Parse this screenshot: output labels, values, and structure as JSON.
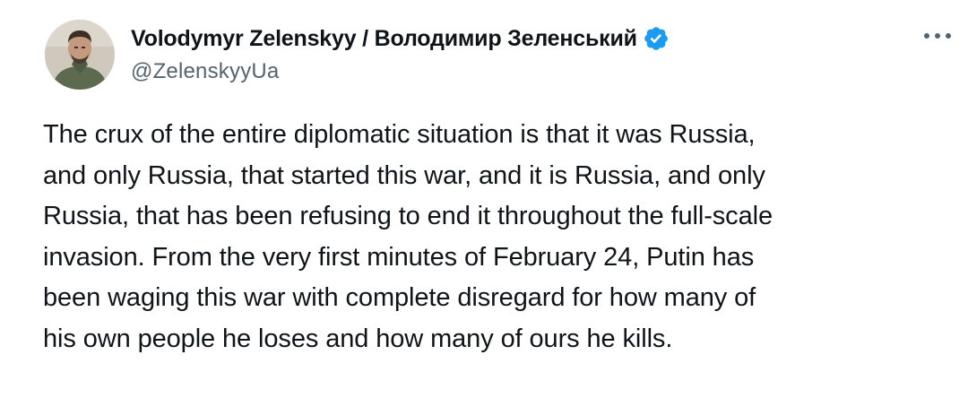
{
  "author": {
    "display_name": "Volodymyr Zelenskyy / Володимир Зеленський",
    "handle": "@ZelenskyyUa",
    "verified_icon": "verified-badge-icon",
    "verified_color": "#1d9bf0"
  },
  "menu": {
    "icon": "more-options-icon"
  },
  "tweet": {
    "lines": [
      "The crux of the entire diplomatic situation is that it was Russia,",
      "and only Russia, that started this war, and it is Russia, and only",
      "Russia, that has been refusing to end it throughout the full-scale",
      "invasion. From the very first minutes of February 24, Putin has",
      "been waging this war with complete disregard for how many of",
      "his own people he loses and how many of ours he kills."
    ]
  }
}
